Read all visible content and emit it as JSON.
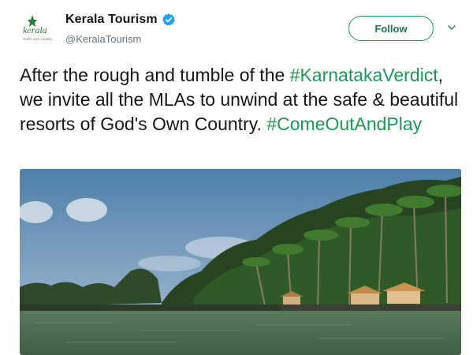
{
  "account": {
    "display_name": "Kerala Tourism",
    "handle": "@KeralaTourism",
    "avatar_logo_text": "kerala",
    "avatar_tagline": "God's own country",
    "verified_icon": "verified-badge-icon"
  },
  "actions": {
    "follow_label": "Follow",
    "more_icon": "chevron-down-icon"
  },
  "tweet": {
    "segments": [
      {
        "text": "After the rough and tumble of the ",
        "type": "text"
      },
      {
        "text": "#KarnatakaVerdict",
        "type": "hashtag"
      },
      {
        "text": ", we invite all the MLAs to unwind at the safe & beautiful resorts of God's Own Country. ",
        "type": "text"
      },
      {
        "text": "#ComeOutAndPlay",
        "type": "hashtag"
      }
    ]
  },
  "media": {
    "subject": "backwater-coconut-palms-resort-photo"
  },
  "colors": {
    "accent": "#1c9a55",
    "verified": "#1da1f2",
    "text": "#14171a",
    "secondary": "#657786"
  }
}
